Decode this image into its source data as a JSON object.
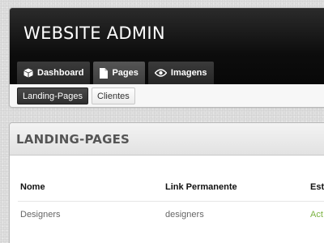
{
  "header": {
    "site_title": "WEBSITE ADMIN"
  },
  "main_tabs": [
    {
      "label": "Dashboard",
      "icon": "cube-icon",
      "active": false
    },
    {
      "label": "Pages",
      "icon": "document-icon",
      "active": true
    },
    {
      "label": "Imagens",
      "icon": "eye-icon",
      "active": false
    }
  ],
  "sub_tabs": [
    {
      "label": "Landing-Pages",
      "active": true
    },
    {
      "label": "Clientes",
      "active": false
    }
  ],
  "content": {
    "title": "LANDING-PAGES",
    "table": {
      "headers": [
        "Nome",
        "Link Permanente",
        "Esta"
      ],
      "rows": [
        [
          "Designers",
          "designers",
          "Act"
        ]
      ]
    }
  },
  "colors": {
    "header_bg": "#0d0d0d",
    "status_active": "#7cb342"
  }
}
